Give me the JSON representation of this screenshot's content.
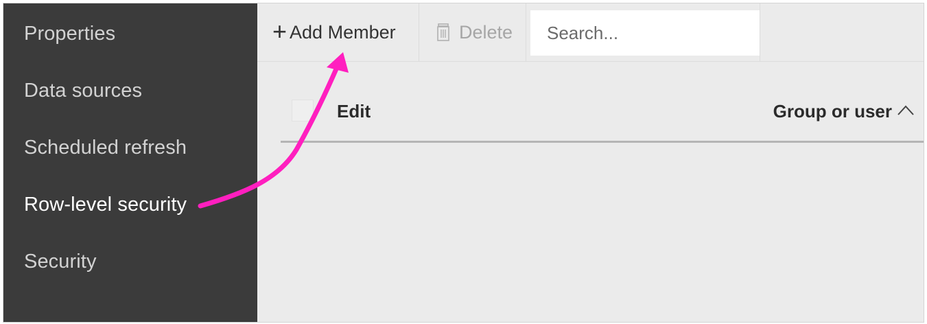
{
  "sidebar": {
    "items": [
      {
        "label": "Properties",
        "active": false
      },
      {
        "label": "Data sources",
        "active": false
      },
      {
        "label": "Scheduled refresh",
        "active": false
      },
      {
        "label": "Row-level security",
        "active": true
      },
      {
        "label": "Security",
        "active": false
      }
    ]
  },
  "toolbar": {
    "add_label": "Add Member",
    "delete_label": "Delete",
    "search_placeholder": "Search..."
  },
  "table": {
    "columns": [
      "Edit",
      "Group or user"
    ],
    "sort": "ascending",
    "rows": []
  },
  "colors": {
    "sidebar_bg": "#3b3b3b",
    "main_bg": "#ebebeb",
    "annotation_arrow": "#ff1fbf"
  },
  "icons": {
    "add": "plus-icon",
    "delete": "trash-icon",
    "sort": "chevron-up-icon"
  }
}
